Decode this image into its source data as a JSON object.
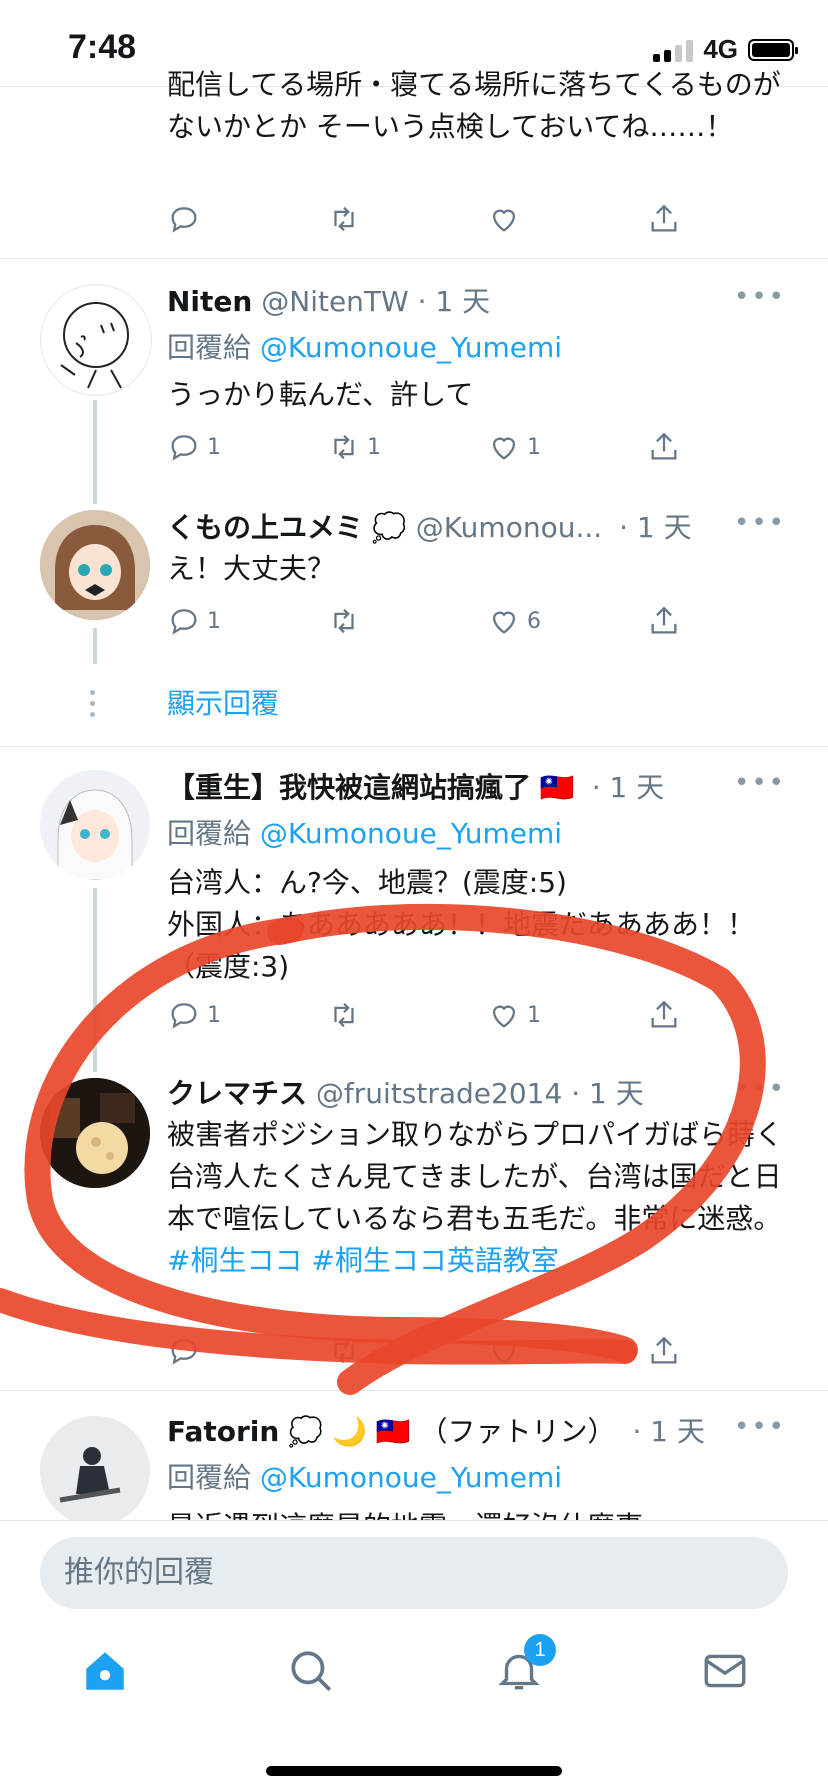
{
  "status": {
    "time": "7:48",
    "network": "4G"
  },
  "tweets": [
    {
      "text": "配信してる場所・寝てる場所に落ちてくるものがないかとか そーいう点検しておいてね……！",
      "actions": {
        "reply": "",
        "retweet": "",
        "like": ""
      }
    },
    {
      "name": "Niten",
      "handle": "@NitenTW",
      "time": "· 1 天",
      "reply_prefix": "回覆給",
      "reply_to": "@Kumonoue_Yumemi",
      "text": "うっかり転んだ、許して",
      "actions": {
        "reply": "1",
        "retweet": "1",
        "like": "1"
      }
    },
    {
      "name": "くもの上ユメミ",
      "name_emoji": "💭",
      "handle": "@Kumonou...",
      "time": "· 1 天",
      "text": "え！大丈夫？",
      "actions": {
        "reply": "1",
        "retweet": "",
        "like": "6"
      }
    },
    {
      "name": "【重生】我快被這網站搞瘋了",
      "name_emoji": "🇹🇼",
      "time": "· 1 天",
      "reply_prefix": "回覆給",
      "reply_to": "@Kumonoue_Yumemi",
      "text_lines": [
        "台湾人：ん?今、地震？(震度:5)",
        "外国人：ああああああ！！地震だああああ！！（震度:3)"
      ],
      "actions": {
        "reply": "1",
        "retweet": "",
        "like": "1"
      }
    },
    {
      "name": "クレマチス",
      "handle": "@fruitstrade2014",
      "time": "· 1 天",
      "text": "被害者ポジション取りながらプロパイガばら蒔く台湾人たくさん見てきましたが、台湾は国だと日本で喧伝しているなら君も五毛だ。非常に迷惑。",
      "hashtags": "#桐生ココ #桐生ココ英語教室",
      "actions": {
        "reply": "",
        "retweet": "",
        "like": ""
      }
    },
    {
      "name": "Fatorin",
      "name_emoji": "💭 🌙 🇹🇼",
      "name_suffix": "（ファトリン）",
      "time": "· 1 天",
      "reply_prefix": "回覆給",
      "reply_to": "@Kumonoue_Yumemi",
      "text": "最近遇到這麼是的地震，還好沒什麼事"
    }
  ],
  "show_replies": "顯示回覆",
  "compose": {
    "placeholder": "推你的回覆"
  },
  "tabs": {
    "notification_badge": "1"
  },
  "colors": {
    "accent": "#1da1f2",
    "annotation": "#e8462a"
  }
}
